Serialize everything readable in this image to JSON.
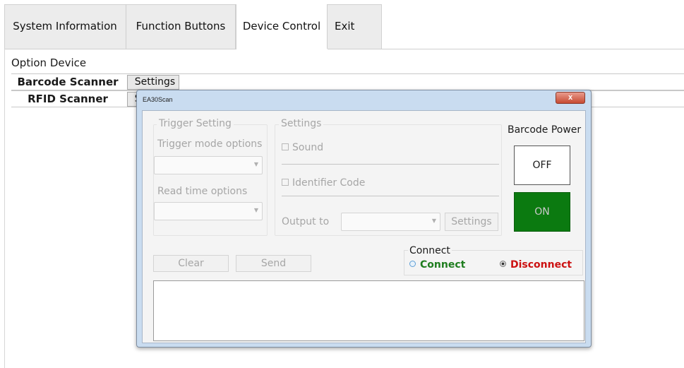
{
  "tabs": [
    "System Information",
    "Function Buttons",
    "Device Control",
    "Exit"
  ],
  "active_tab": "Device Control",
  "option_device": {
    "title": "Option Device",
    "rows": [
      {
        "label": "Barcode Scanner",
        "button": "Settings"
      },
      {
        "label": "RFID Scanner",
        "button": "Settings"
      }
    ]
  },
  "dialog": {
    "title": "EA30Scan",
    "close": "x",
    "trigger_setting": {
      "legend": "Trigger Setting",
      "mode_label": "Trigger mode options",
      "mode_value": "",
      "read_label": "Read time options",
      "read_value": ""
    },
    "settings": {
      "legend": "Settings",
      "sound": "Sound",
      "identifier": "Identifier Code",
      "output_label": "Output to",
      "output_value": "",
      "settings_button": "Settings"
    },
    "barcode_power": {
      "title": "Barcode Power",
      "off": "OFF",
      "on": "ON"
    },
    "actions": {
      "clear": "Clear",
      "send": "Send"
    },
    "connect": {
      "legend": "Connect",
      "connect_label": "Connect",
      "disconnect_label": "Disconnect",
      "selected": "Disconnect"
    },
    "output_text": ""
  },
  "colors": {
    "on_green": "#0b7a10",
    "connect_green": "#1e7d1e",
    "disconnect_red": "#cc1111",
    "dialog_frame": "#c9dcf0"
  }
}
